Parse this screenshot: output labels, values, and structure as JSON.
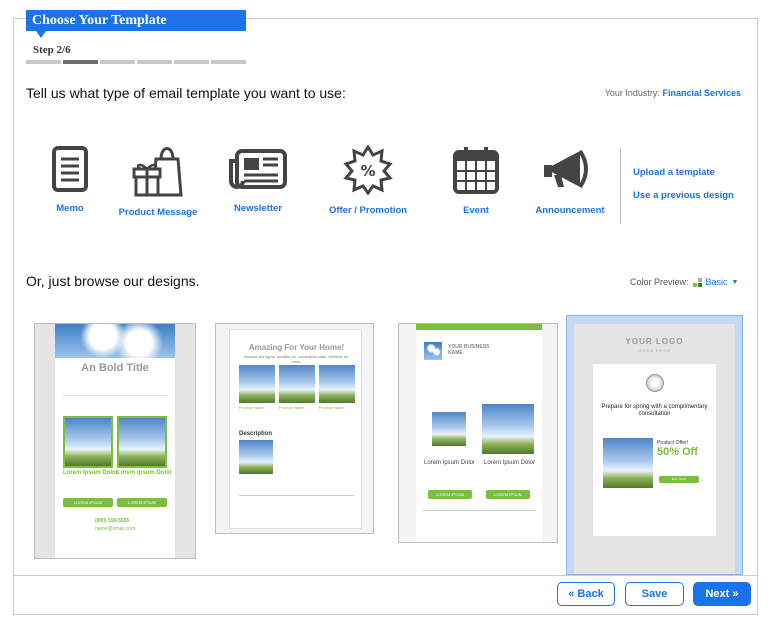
{
  "wizard": {
    "title": "Choose Your Template",
    "step": "Step 2/6",
    "total_steps": 6,
    "current_step": 2
  },
  "heading": "Tell us what type of email template you want to use:",
  "industry": {
    "label": "Your Industry:",
    "value": "Financial Services"
  },
  "types": [
    {
      "label": "Memo",
      "icon": "memo-icon"
    },
    {
      "label": "Product Message",
      "icon": "gift-bag-icon"
    },
    {
      "label": "Newsletter",
      "icon": "newspaper-icon"
    },
    {
      "label": "Offer / Promotion",
      "icon": "percent-badge-icon"
    },
    {
      "label": "Event",
      "icon": "calendar-icon"
    },
    {
      "label": "Announcement",
      "icon": "megaphone-icon"
    }
  ],
  "side_links": {
    "upload": "Upload a template",
    "previous": "Use a previous design"
  },
  "browse_heading": "Or, just browse our designs.",
  "color_preview": {
    "label": "Color Preview:",
    "value": "Basic"
  },
  "designs": {
    "d1": {
      "title": "An Bold Title",
      "sub1": "Lorem Ipsum Dolor",
      "sub2": "Lorem Ipsum Dolor",
      "btn1": "LOREM IPSUM",
      "btn2": "LOREM IPSUM",
      "phone": "(800) 555-5555",
      "email": "name@email.com"
    },
    "d2": {
      "title": "Amazing For Your Home!",
      "subtitle": "Aenean leo ligula, porttitor eu, consequat vitae, eleifend ac, enim.",
      "desc_heading": "Description",
      "cap1": "Product Name",
      "cap2": "Product Name",
      "cap3": "Product Name"
    },
    "d3": {
      "biz1": "YOUR BUSINESS",
      "biz2": "NAME",
      "cap1": "Lorem Ipsum Dolor",
      "cap2": "Lorem Ipsum Dolor",
      "btn1": "LOREM IPSUM",
      "btn2": "LOREM IPSUM"
    },
    "d4": {
      "logo": "YOUR LOGO",
      "logo_sub": "GOES HERE",
      "headline": "Prepare for spring with a complimentary consultation",
      "offer_label": "Product Offer!",
      "offer": "50% Off",
      "btn": "BUY NOW"
    }
  },
  "buttons": {
    "back": "« Back",
    "save": "Save",
    "next": "Next »"
  },
  "colors": {
    "accent": "#1a73e8",
    "green": "#7cbf3a",
    "selected_bg": "#c5d9f3"
  }
}
